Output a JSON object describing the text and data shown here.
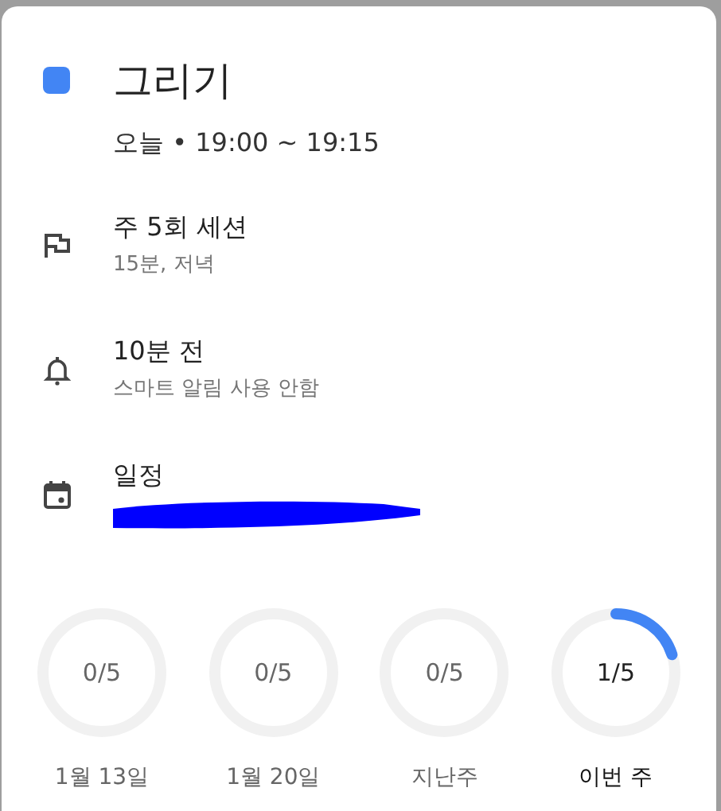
{
  "event": {
    "color": "#4285f4",
    "title": "그리기",
    "when": "오늘 • 19:00 ~ 19:15"
  },
  "details": [
    {
      "kind": "goal",
      "title": "주 5회 세션",
      "subtitle": "15분, 저녁"
    },
    {
      "kind": "reminder",
      "title": "10분 전",
      "subtitle": "스마트 알림 사용 안함"
    },
    {
      "kind": "calendar",
      "title": "일정",
      "redacted": true
    }
  ],
  "weeks": [
    {
      "count": "0/5",
      "label": "1월 13일",
      "selected": false
    },
    {
      "count": "0/5",
      "label": "1월 20일",
      "selected": false
    },
    {
      "count": "0/5",
      "label": "지난주",
      "selected": false
    },
    {
      "count": "1/5",
      "label": "이번 주",
      "selected": true
    }
  ]
}
